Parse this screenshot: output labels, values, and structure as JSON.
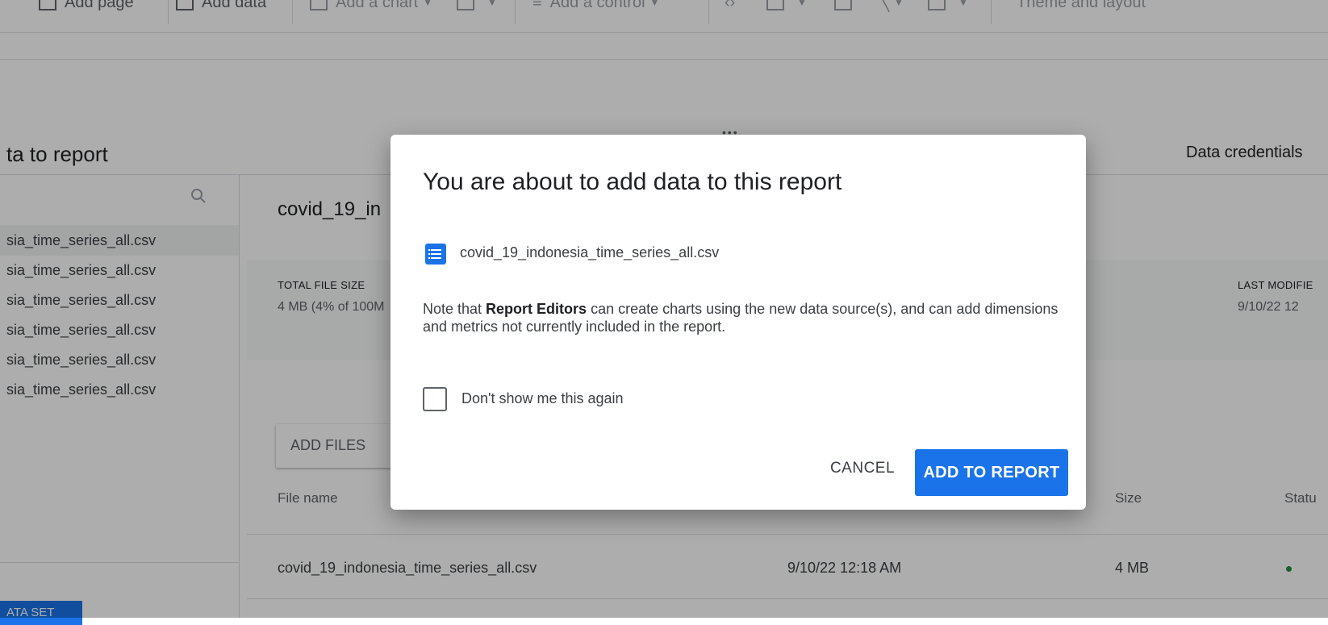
{
  "toolbar": {
    "add_page": "Add page",
    "add_data": "Add data",
    "add_chart": "Add a chart",
    "add_control": "Add a control",
    "theme_layout": "Theme and layout"
  },
  "panel": {
    "title": "ta to report",
    "data_credentials": "Data credentials",
    "left_items": [
      "sia_time_series_all.csv",
      "sia_time_series_all.csv",
      "sia_time_series_all.csv",
      "sia_time_series_all.csv",
      "sia_time_series_all.csv",
      "sia_time_series_all.csv"
    ],
    "new_dataset_label": "ATA SET",
    "right_title": "covid_19_in",
    "total_file_size_label": "TOTAL FILE SIZE",
    "total_file_size_value": "4 MB (4% of 100M",
    "last_modified_label": "LAST MODIFIE",
    "last_modified_value": "9/10/22 12",
    "add_files": "ADD FILES",
    "columns": {
      "file_name": "File name",
      "size": "Size",
      "status": "Statu"
    },
    "row": {
      "file_name": "covid_19_indonesia_time_series_all.csv",
      "modified": "9/10/22 12:18 AM",
      "size": "4 MB"
    }
  },
  "dialog": {
    "title": "You are about to add data to this report",
    "file_name": "covid_19_indonesia_time_series_all.csv",
    "note_prefix": "Note that ",
    "note_bold": "Report Editors",
    "note_suffix": " can create charts using the new data source(s), and can add dimensions and metrics not currently included in the report.",
    "dont_show": "Don't show me this again",
    "cancel": "CANCEL",
    "add_to_report": "ADD TO REPORT"
  },
  "colors": {
    "accent": "#1a73e8",
    "status_ok": "#1e8e3e"
  }
}
